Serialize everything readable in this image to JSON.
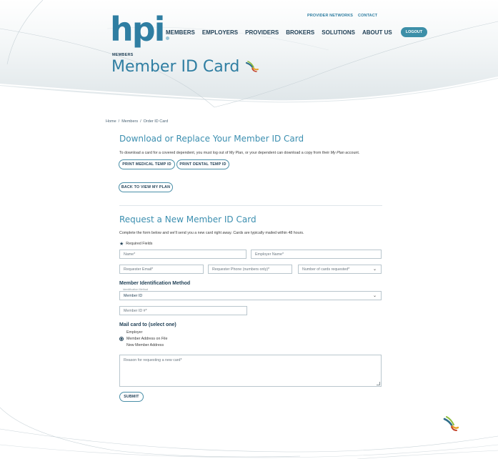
{
  "header": {
    "logo_text": "hpi",
    "utility_nav": [
      "PROVIDER NETWORKS",
      "CONTACT"
    ],
    "main_nav": [
      "MEMBERS",
      "EMPLOYERS",
      "PROVIDERS",
      "BROKERS",
      "SOLUTIONS",
      "ABOUT US"
    ],
    "logout_label": "LOGOUT",
    "eyebrow": "MEMBERS",
    "page_title": "Member ID Card"
  },
  "breadcrumb": [
    "Home",
    "/",
    "Members",
    "/",
    "Order ID Card"
  ],
  "download_section": {
    "heading": "Download or Replace Your Member ID Card",
    "text_before": "To download a card for a covered dependent, you must log out of My Plan, or your dependent can download a copy from their ",
    "text_em": "My Plan",
    "text_after": " account.",
    "print_medical_label": "PRINT MEDICAL TEMP ID",
    "print_dental_label": "PRINT DENTAL TEMP ID",
    "back_label": "BACK TO VIEW MY PLAN"
  },
  "request_section": {
    "heading": "Request a New Member ID Card",
    "intro": "Complete the form below and we'll send you a new card right away. Cards are typically mailed within 48 hours.",
    "required_note": "Required Fields",
    "name_placeholder": "Name*",
    "employer_placeholder": "Employer Name*",
    "email_placeholder": "Requester Email*",
    "phone_placeholder": "Requester Phone (numbers only)*",
    "cards_placeholder": "Number of cards requested*",
    "id_method_heading": "Member Identification Method",
    "id_method_label": "Identification Method",
    "id_method_value": "Member ID",
    "member_id_placeholder": "Member ID #*",
    "mail_heading": "Mail card to (select one)",
    "mail_options": [
      {
        "label": "Employer",
        "selected": false
      },
      {
        "label": "Member Address on File",
        "selected": true
      },
      {
        "label": "New Member Address",
        "selected": false
      }
    ],
    "reason_placeholder": "Reason for requesting a new card*",
    "submit_label": "SUBMIT"
  },
  "colors": {
    "brand_blue": "#2f7ea2",
    "navy": "#1f3f55",
    "button_border": "#4a8fa8",
    "logout_bg": "#3d8fa8"
  },
  "icons": {
    "title_icon": "dragonfly-icon",
    "footer_icon": "dragonfly-icon",
    "required_icon": "star-icon",
    "dropdown_icon": "chevron-down-icon"
  }
}
